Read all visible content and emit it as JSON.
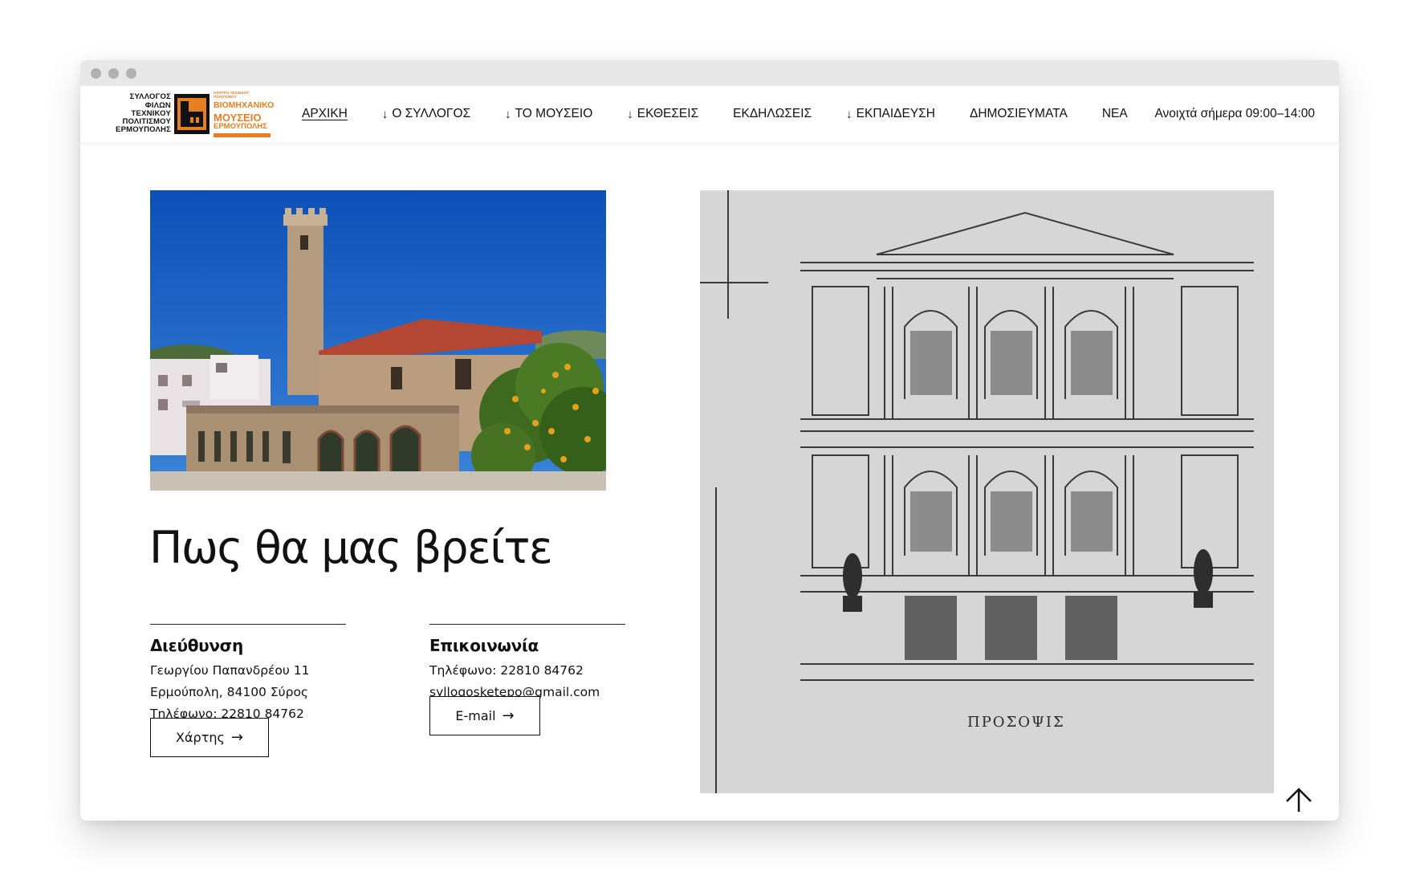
{
  "logo": {
    "left_text": [
      "ΣΥΛΛΟΓΟΣ",
      "ΦΙΛΩΝ",
      "ΤΕΧΝΙΚΟΥ",
      "ΠΟΛΙΤΙΣΜΟΥ",
      "ΕΡΜΟΥΠΟΛΗΣ"
    ],
    "right_tiny": "ΚΕΝΤΡΟ ΤΕΧΝΙΚΟΥ ΠΟΛΙΤΙΣΜΟΥ",
    "right_line1": "ΒΙΟΜΗΧΑΝΙΚΟ",
    "right_line2": "ΜΟΥΣΕΙΟ",
    "right_line3": "ΕΡΜΟΥΠΟΛΗΣ"
  },
  "nav": {
    "items": [
      {
        "label": "ΑΡΧΙΚΗ",
        "arrow": "",
        "active": true
      },
      {
        "label": "Ο ΣΥΛΛΟΓΟΣ",
        "arrow": "↓",
        "active": false
      },
      {
        "label": "ΤΟ ΜΟΥΣΕΙΟ",
        "arrow": "↓",
        "active": false
      },
      {
        "label": "ΕΚΘΕΣΕΙΣ",
        "arrow": "↓",
        "active": false
      },
      {
        "label": "ΕΚΔΗΛΩΣΕΙΣ",
        "arrow": "",
        "active": false
      },
      {
        "label": "ΕΚΠΑΙΔΕΥΣΗ",
        "arrow": "↓",
        "active": false
      },
      {
        "label": "ΔΗΜΟΣΙΕΥΜΑΤΑ",
        "arrow": "",
        "active": false
      },
      {
        "label": "ΝΕΑ",
        "arrow": "",
        "active": false
      }
    ],
    "open_hours": "Ανοιχτά σήμερα 09:00–14:00"
  },
  "main": {
    "heading": "Πως θα μας βρείτε",
    "address": {
      "title": "Διεύθυνση",
      "lines": "Γεωργίου Παπανδρέου 11\nΕρμούπολη, 84100 Σύρος\nΤηλέφωνο: 22810 84762",
      "button_label": "Χάρτης"
    },
    "contact": {
      "title": "Επικοινωνία",
      "lines": "Τηλέφωνο: 22810 84762\nsyllogosketepo@gmail.com",
      "button_label": "E-mail"
    },
    "sketch_caption": "ΠΡΟΣΟΨΙΣ"
  },
  "icons": {
    "button_arrow": "→",
    "scroll_top": "arrow-up-icon"
  },
  "colors": {
    "brand_orange": "#e67e22",
    "text": "#111111",
    "sky": "#1560c8"
  }
}
